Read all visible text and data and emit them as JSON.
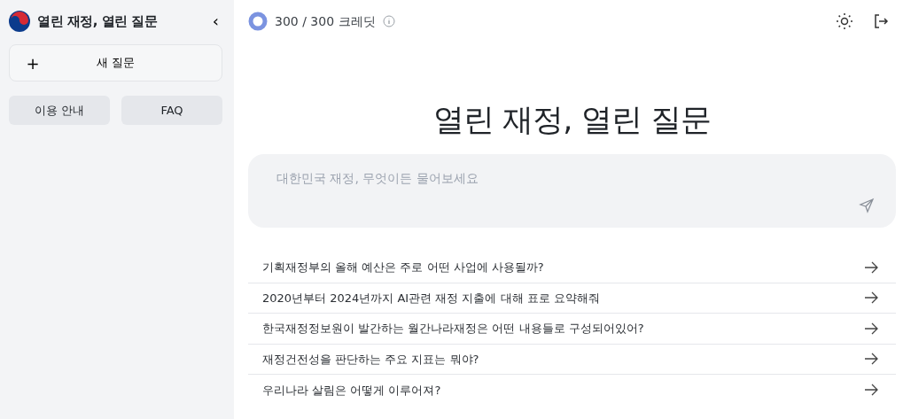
{
  "sidebar": {
    "title": "열린 재정, 열린 질문",
    "collapse_icon": "‹",
    "new_question": {
      "icon": "+",
      "label": "새 질문"
    },
    "links": [
      "이용 안내",
      "FAQ"
    ]
  },
  "header": {
    "credits": "300 / 300 크레딧"
  },
  "main": {
    "heading": "열린 재정, 열린 질문",
    "input": {
      "placeholder": "대한민국 재정, 무엇이든 물어보세요"
    },
    "suggestions": [
      {
        "text": "기획재정부의 올해 예산은 주로 어떤 사업에 사용될까?"
      },
      {
        "text": "2020년부터 2024년까지 AI관련 재정 지출에 대해 표로 요약해줘"
      },
      {
        "text": "한국재정정보원이 발간하는 월간나라재정은 어떤 내용들로 구성되어있어?"
      },
      {
        "text": "재정건전성을 판단하는 주요 지표는 뭐야?"
      },
      {
        "text": "우리나라 살림은 어떻게 이루어져?"
      }
    ]
  }
}
